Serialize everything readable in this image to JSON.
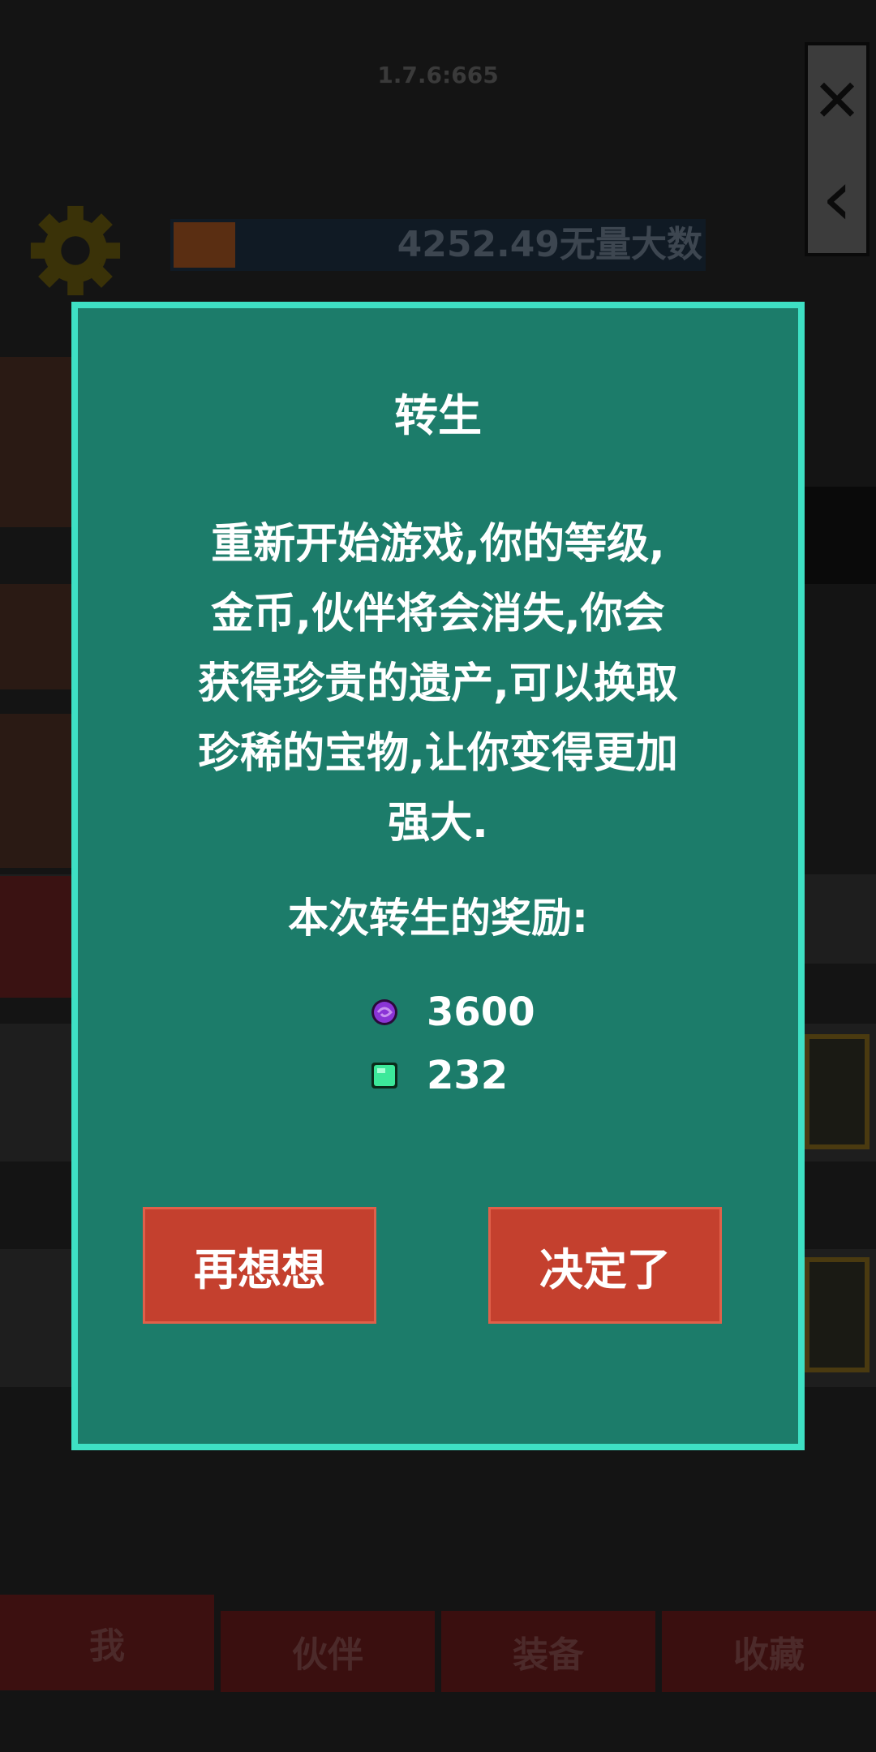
{
  "app": {
    "version": "1.7.6:665"
  },
  "side_panel": {
    "close_glyph": "✕",
    "back_glyph": "‹"
  },
  "currency": {
    "amount_text": "4252.49无量大数"
  },
  "dialog": {
    "title": "转生",
    "body_lines": [
      "重新开始游戏,你的等级,",
      "金币,伙伴将会消失,你会",
      "获得珍贵的遗产,可以换取",
      "珍稀的宝物,让你变得更加",
      "强大."
    ],
    "reward_heading": "本次转生的奖励:",
    "rewards": [
      {
        "icon": "purple-orb-icon",
        "color": "#8a34d6",
        "value": "3600"
      },
      {
        "icon": "green-gem-icon",
        "color": "#3ce89a",
        "value": "232"
      }
    ],
    "cancel_label": "再想想",
    "confirm_label": "决定了"
  },
  "nav": {
    "tabs": [
      "我",
      "伙伴",
      "装备",
      "收藏"
    ]
  },
  "colors": {
    "dialog_bg": "#1c7c6a",
    "dialog_border": "#3ee0c4",
    "button_red": "#c4402e"
  }
}
